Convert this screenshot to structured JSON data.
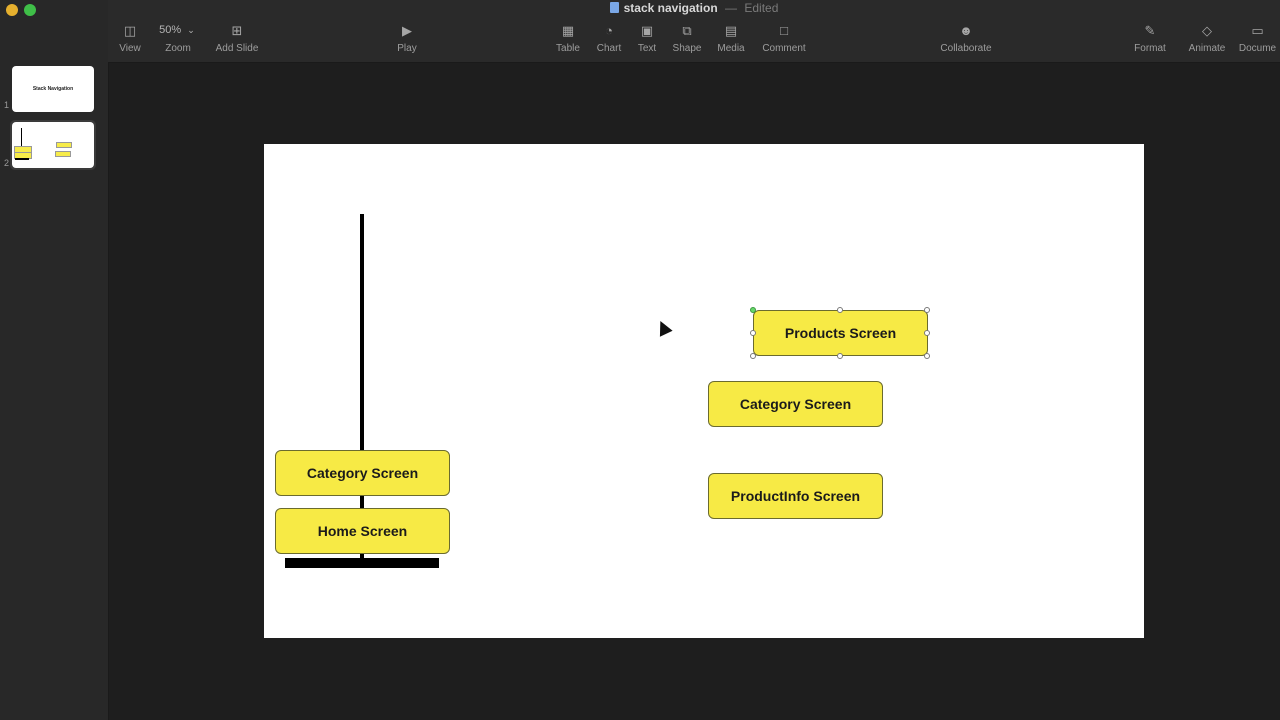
{
  "window": {
    "doc_title": "stack navigation",
    "separator": "—",
    "status": "Edited"
  },
  "toolbar": {
    "view": {
      "label": "View",
      "icon": "sidebar-icon"
    },
    "zoom": {
      "label": "Zoom",
      "value": "50%",
      "icon": "chevron-down-icon"
    },
    "add_slide": {
      "label": "Add Slide",
      "icon": "plus-square-icon"
    },
    "play": {
      "label": "Play",
      "icon": "play-icon"
    },
    "table": {
      "label": "Table",
      "icon": "table-icon"
    },
    "chart": {
      "label": "Chart",
      "icon": "chart-icon"
    },
    "text": {
      "label": "Text",
      "icon": "text-box-icon"
    },
    "shape": {
      "label": "Shape",
      "icon": "shape-icon"
    },
    "media": {
      "label": "Media",
      "icon": "image-icon"
    },
    "comment": {
      "label": "Comment",
      "icon": "comment-icon"
    },
    "collaborate": {
      "label": "Collaborate",
      "icon": "collaborate-icon"
    },
    "format": {
      "label": "Format",
      "icon": "paintbrush-icon"
    },
    "animate": {
      "label": "Animate",
      "icon": "diamond-icon"
    },
    "document": {
      "label": "Docume",
      "icon": "document-icon"
    }
  },
  "sidebar": {
    "slides": [
      {
        "number": "1",
        "title": "Stack Navigation"
      },
      {
        "number": "2",
        "title": ""
      }
    ]
  },
  "slide": {
    "stack": {
      "top_box": "Category Screen",
      "bottom_box": "Home Screen"
    },
    "queue": {
      "selected_box": "Products Screen",
      "middle_box": "Category Screen",
      "bottom_box": "ProductInfo Screen"
    }
  },
  "colors": {
    "box_fill": "#f7ea45",
    "canvas_bg": "#1e1e1e",
    "toolbar_bg": "#2a2a2a",
    "slide_bg": "#ffffff"
  }
}
